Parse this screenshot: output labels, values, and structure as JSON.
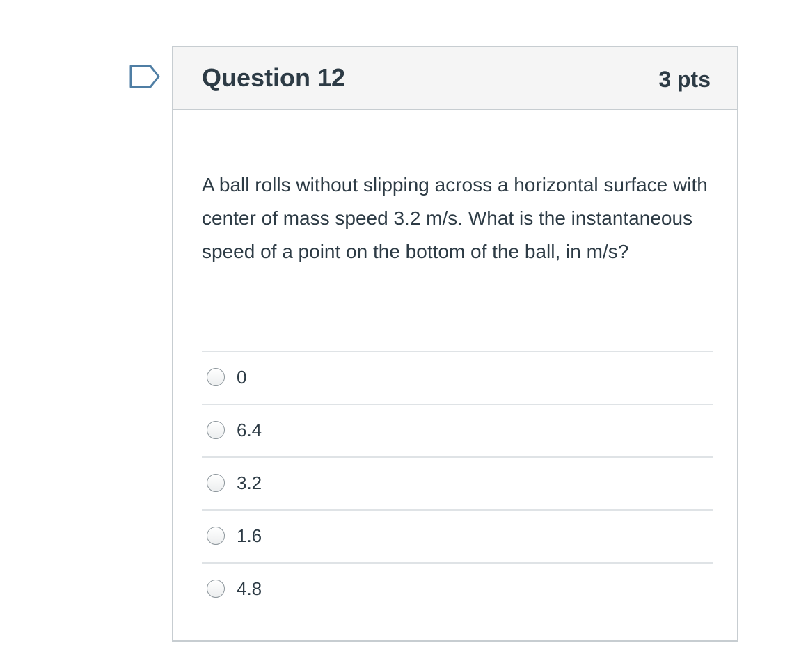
{
  "question": {
    "title": "Question 12",
    "points": "3 pts",
    "text": "A ball rolls without slipping across a horizontal surface with center of mass speed 3.2 m/s. What is the instantaneous speed of a point on the bottom of the ball, in m/s?",
    "flag_icon": "flag-icon",
    "answers": [
      {
        "label": "0"
      },
      {
        "label": "6.4"
      },
      {
        "label": "3.2"
      },
      {
        "label": "1.6"
      },
      {
        "label": "4.8"
      }
    ]
  },
  "colors": {
    "text": "#2d3b45",
    "border": "#c7cdd1",
    "header_bg": "#f5f5f5",
    "divider": "#dfe3e6",
    "flag": "#4f7ea4"
  }
}
